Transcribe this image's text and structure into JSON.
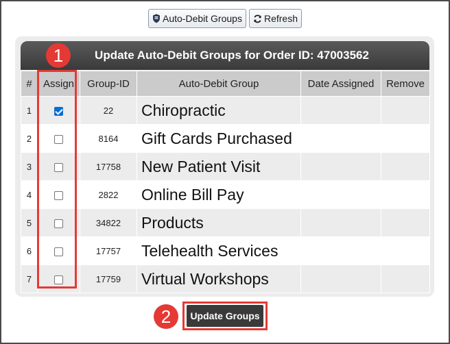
{
  "toolbar": {
    "auto_debit_label": "Auto-Debit Groups",
    "refresh_label": "Refresh"
  },
  "header": {
    "title": "Update Auto-Debit Groups for Order ID: 47003562"
  },
  "table": {
    "columns": [
      "#",
      "Assign",
      "Group-ID",
      "Auto-Debit Group",
      "Date Assigned",
      "Remove"
    ],
    "rows": [
      {
        "index": "1",
        "assigned": true,
        "group_id": "22",
        "group": "Chiropractic",
        "date_assigned": "",
        "remove": ""
      },
      {
        "index": "2",
        "assigned": false,
        "group_id": "8164",
        "group": "Gift Cards Purchased",
        "date_assigned": "",
        "remove": ""
      },
      {
        "index": "3",
        "assigned": false,
        "group_id": "17758",
        "group": "New Patient Visit",
        "date_assigned": "",
        "remove": ""
      },
      {
        "index": "4",
        "assigned": false,
        "group_id": "2822",
        "group": "Online Bill Pay",
        "date_assigned": "",
        "remove": ""
      },
      {
        "index": "5",
        "assigned": false,
        "group_id": "34822",
        "group": "Products",
        "date_assigned": "",
        "remove": ""
      },
      {
        "index": "6",
        "assigned": false,
        "group_id": "17757",
        "group": "Telehealth Services",
        "date_assigned": "",
        "remove": ""
      },
      {
        "index": "7",
        "assigned": false,
        "group_id": "17759",
        "group": "Virtual Workshops",
        "date_assigned": "",
        "remove": ""
      }
    ]
  },
  "annotations": {
    "marker_1": "1",
    "marker_2": "2"
  },
  "footer": {
    "update_label": "Update Groups"
  },
  "colors": {
    "highlight": "#e53935",
    "header_bg": "#3a3a3a",
    "checkbox_checked": "#0a6ed1"
  }
}
